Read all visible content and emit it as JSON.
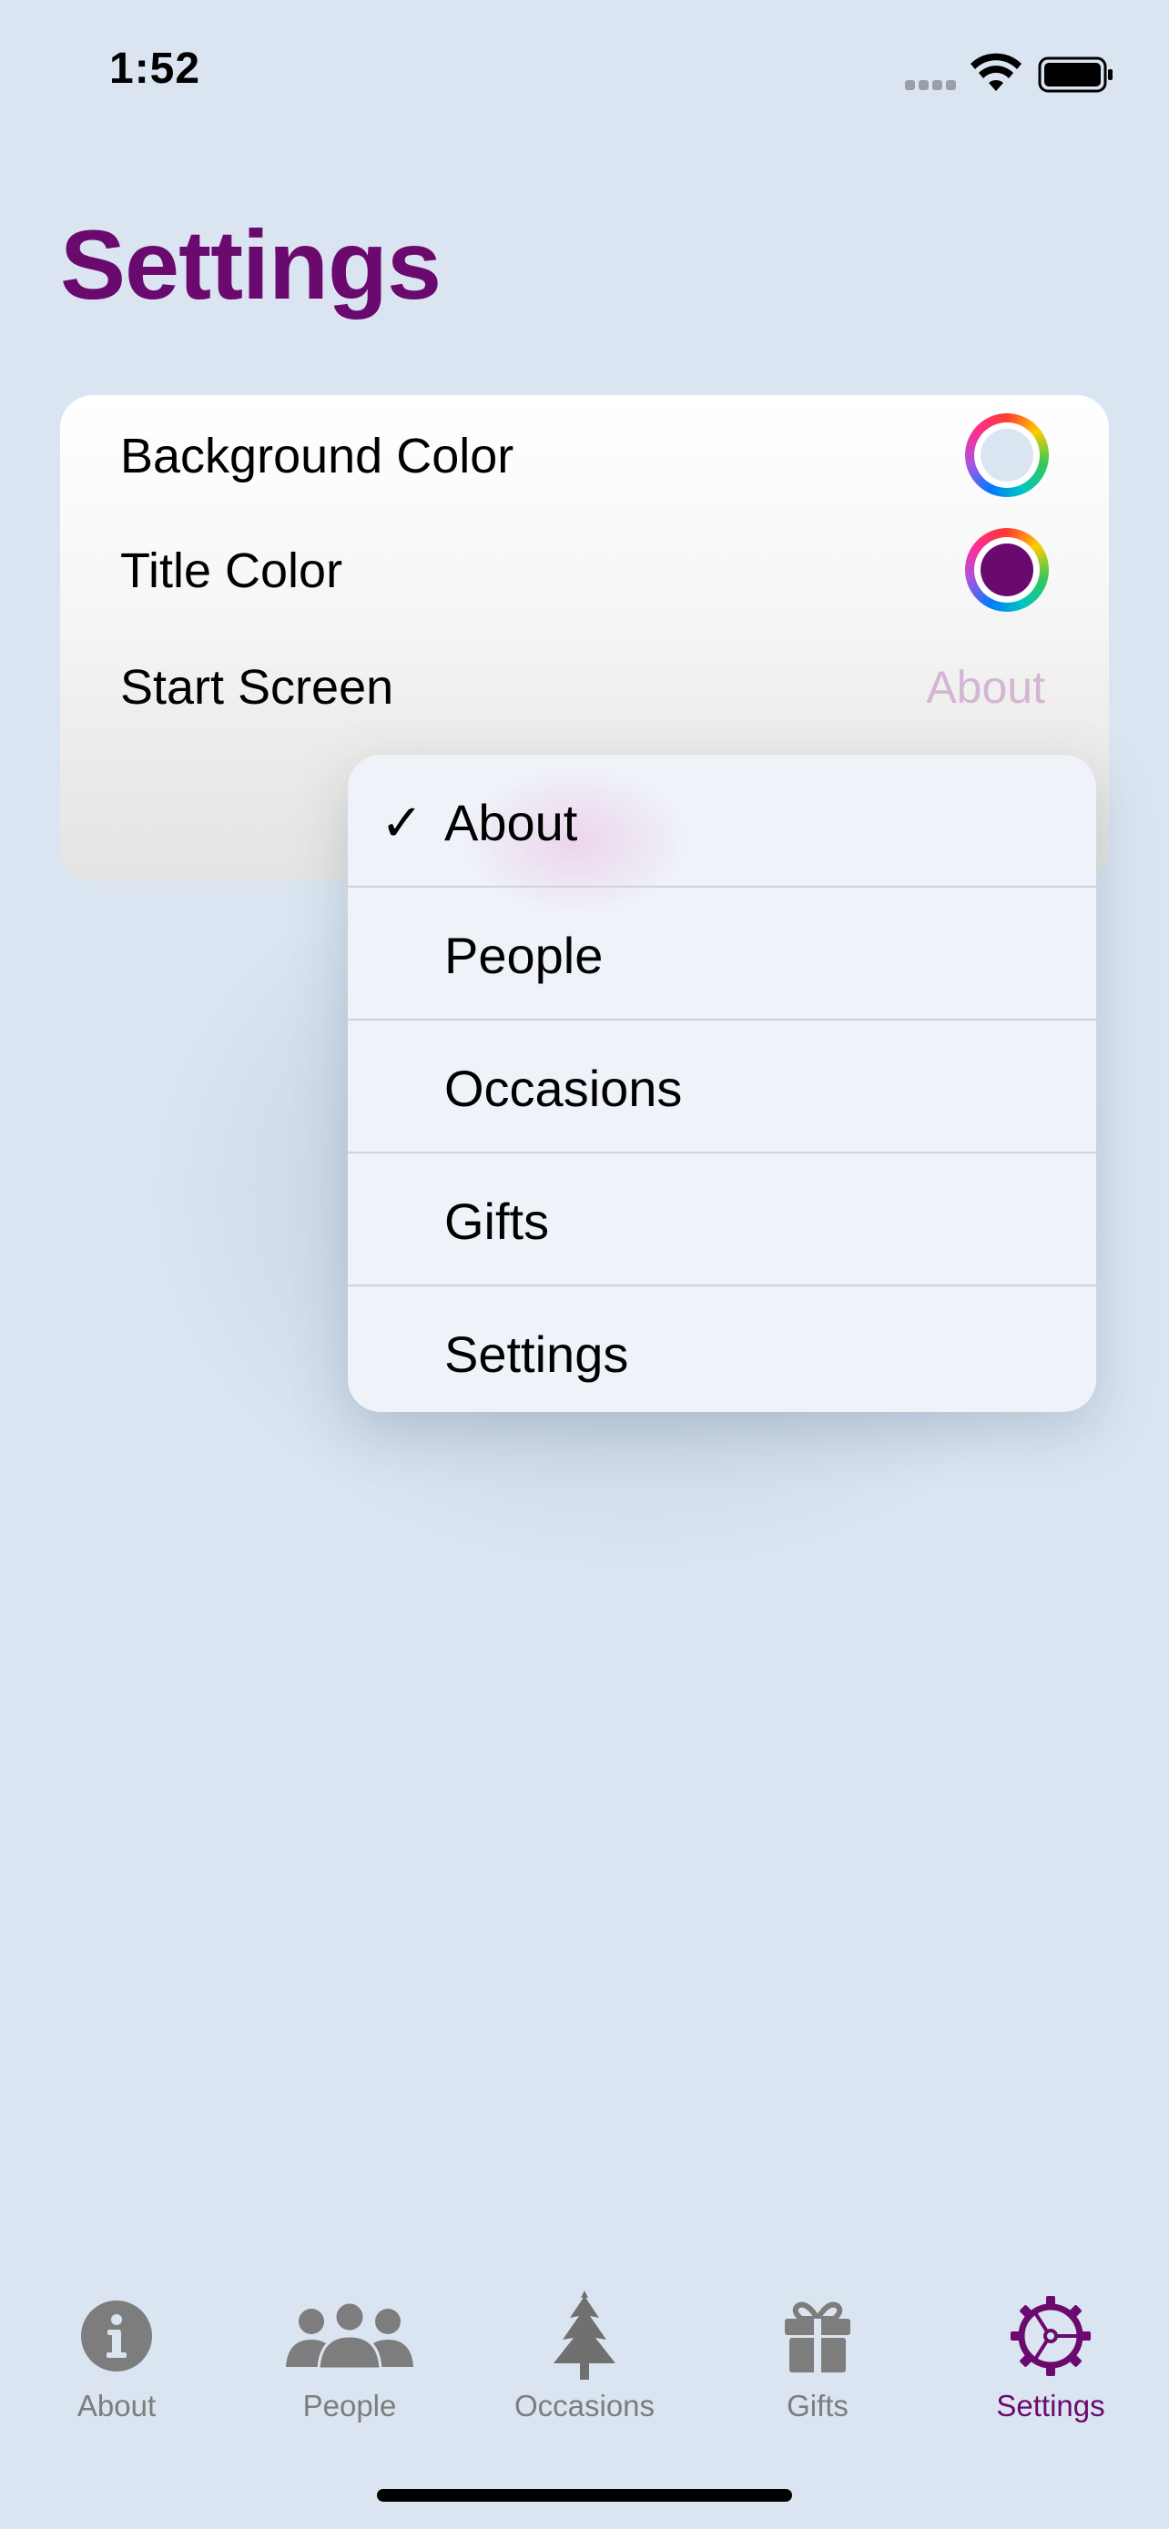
{
  "status_bar": {
    "time": "1:52"
  },
  "page": {
    "title": "Settings"
  },
  "settings": {
    "background_color": {
      "label": "Background Color",
      "value_hex": "#dae5f1"
    },
    "title_color": {
      "label": "Title Color",
      "value_hex": "#6b0a6e"
    },
    "start_screen": {
      "label": "Start Screen",
      "value": "About"
    }
  },
  "menu": {
    "selected_index": 0,
    "items": [
      {
        "label": "About",
        "checked": true,
        "check_glyph": "✓"
      },
      {
        "label": "People",
        "checked": false
      },
      {
        "label": "Occasions",
        "checked": false
      },
      {
        "label": "Gifts",
        "checked": false
      },
      {
        "label": "Settings",
        "checked": false
      }
    ]
  },
  "tab_bar": {
    "active": "Settings",
    "tabs": [
      {
        "label": "About",
        "icon": "info-circle-icon"
      },
      {
        "label": "People",
        "icon": "people-group-icon"
      },
      {
        "label": "Occasions",
        "icon": "christmas-tree-icon"
      },
      {
        "label": "Gifts",
        "icon": "gift-icon"
      },
      {
        "label": "Settings",
        "icon": "gear-icon"
      }
    ]
  },
  "colors": {
    "accent": "#6b0a6e",
    "background": "#dae5f1",
    "tab_inactive": "#7d7d7d"
  }
}
